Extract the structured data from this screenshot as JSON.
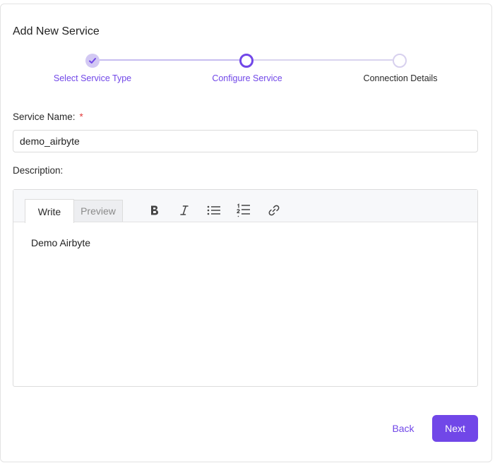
{
  "dialog": {
    "title": "Add New Service"
  },
  "stepper": {
    "steps": [
      {
        "label": "Select Service Type",
        "status": "completed"
      },
      {
        "label": "Configure Service",
        "status": "active"
      },
      {
        "label": "Connection Details",
        "status": "pending"
      }
    ]
  },
  "form": {
    "service_name_label": "Service Name:",
    "required_marker": "*",
    "service_name_value": "demo_airbyte",
    "description_label": "Description:"
  },
  "editor": {
    "tabs": {
      "write": "Write",
      "preview": "Preview"
    },
    "toolbar_icons": [
      "bold-icon",
      "italic-icon",
      "bulleted-list-icon",
      "numbered-list-icon",
      "link-icon"
    ],
    "content": "Demo Airbyte"
  },
  "actions": {
    "back": "Back",
    "next": "Next"
  },
  "colors": {
    "accent": "#7147e8",
    "required": "#e33b3b"
  }
}
